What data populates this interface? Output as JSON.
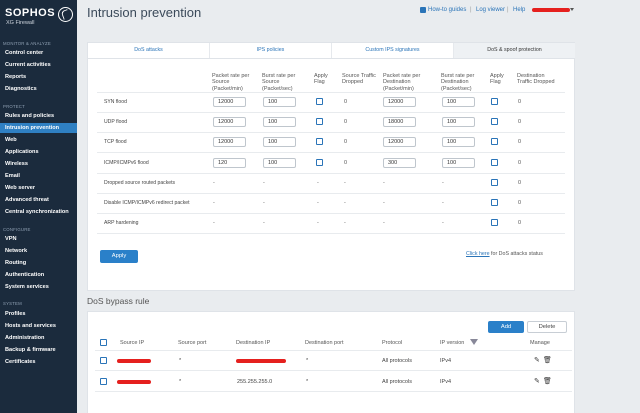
{
  "sidebar": {
    "logo": {
      "word": "SOPHOS",
      "sub": "XG Firewall"
    },
    "sections": [
      {
        "head": "MONITOR & ANALYZE",
        "items": [
          "Control center",
          "Current activities",
          "Reports",
          "Diagnostics"
        ]
      },
      {
        "head": "PROTECT",
        "items": [
          "Rules and policies",
          "Intrusion prevention",
          "Web",
          "Applications",
          "Wireless",
          "Email",
          "Web server",
          "Advanced threat",
          "Central synchronization"
        ]
      },
      {
        "head": "CONFIGURE",
        "items": [
          "VPN",
          "Network",
          "Routing",
          "Authentication",
          "System services"
        ]
      },
      {
        "head": "SYSTEM",
        "items": [
          "Profiles",
          "Hosts and services",
          "Administration",
          "Backup & firmware",
          "Certificates"
        ]
      }
    ],
    "active_item": "Intrusion prevention"
  },
  "header": {
    "title": "Intrusion prevention",
    "links": {
      "howto": "How-to guides",
      "logviewer": "Log viewer",
      "help": "Help"
    },
    "separator": "|"
  },
  "tabs": [
    {
      "label": "DoS attacks",
      "active": false
    },
    {
      "label": "IPS policies",
      "active": false
    },
    {
      "label": "Custom IPS signatures",
      "active": false
    },
    {
      "label": "DoS & spoof protection",
      "active": true
    }
  ],
  "dos_table": {
    "headers": {
      "src_packet": "Packet rate per Source (Packet/min)",
      "src_burst": "Burst rate per Source (Packet/sec)",
      "src_apply": "Apply Flag",
      "src_dropped": "Source Traffic Dropped",
      "dst_packet": "Packet rate per Destination (Packet/min)",
      "dst_burst": "Burst rate per Destination (Packet/sec)",
      "dst_apply": "Apply Flag",
      "dst_dropped": "Destination Traffic Dropped"
    },
    "rows": [
      {
        "label": "SYN flood",
        "src_packet": "12000",
        "src_burst": "100",
        "src_dropped": "0",
        "dst_packet": "12000",
        "dst_burst": "100",
        "dst_dropped": "0"
      },
      {
        "label": "UDP flood",
        "src_packet": "12000",
        "src_burst": "100",
        "src_dropped": "0",
        "dst_packet": "18000",
        "dst_burst": "100",
        "dst_dropped": "0"
      },
      {
        "label": "TCP flood",
        "src_packet": "12000",
        "src_burst": "100",
        "src_dropped": "0",
        "dst_packet": "12000",
        "dst_burst": "100",
        "dst_dropped": "0"
      },
      {
        "label": "ICMP/ICMPv6 flood",
        "src_packet": "120",
        "src_burst": "100",
        "src_dropped": "0",
        "dst_packet": "300",
        "dst_burst": "100",
        "dst_dropped": "0"
      }
    ],
    "flag_rows": [
      {
        "label": "Dropped source routed packets",
        "dash": "-",
        "dropped": "0"
      },
      {
        "label": "Disable ICMP/ICMPv6 redirect packet",
        "dash": "-",
        "dropped": "0"
      },
      {
        "label": "ARP hardening",
        "dash": "-",
        "dropped": "0"
      }
    ],
    "apply_label": "Apply",
    "status_link": "Click here",
    "status_text": " for DoS attacks status"
  },
  "bypass": {
    "title": "DoS bypass rule",
    "add_label": "Add",
    "delete_label": "Delete",
    "headers": {
      "src_ip": "Source IP",
      "src_port": "Source port",
      "dst_ip": "Destination IP",
      "dst_port": "Destination port",
      "protocol": "Protocol",
      "ip_version": "IP version",
      "manage": "Manage"
    },
    "rows": [
      {
        "src_port": "*",
        "dst_ip": "",
        "dst_port": "*",
        "protocol": "All protocols",
        "ip_version": "IPv4"
      },
      {
        "src_port": "*",
        "dst_ip": "255.255.255.0",
        "dst_port": "*",
        "protocol": "All protocols",
        "ip_version": "IPv4"
      }
    ]
  },
  "colors": {
    "sidebar": "#1b2b3d",
    "active": "#2f80c3",
    "accent": "#2a80c9",
    "redaction": "#e5201e"
  },
  "icons": [
    "how-to-guides-icon",
    "user-caret-icon",
    "filter-icon",
    "edit-icon",
    "delete-icon",
    "checkbox-icon"
  ]
}
